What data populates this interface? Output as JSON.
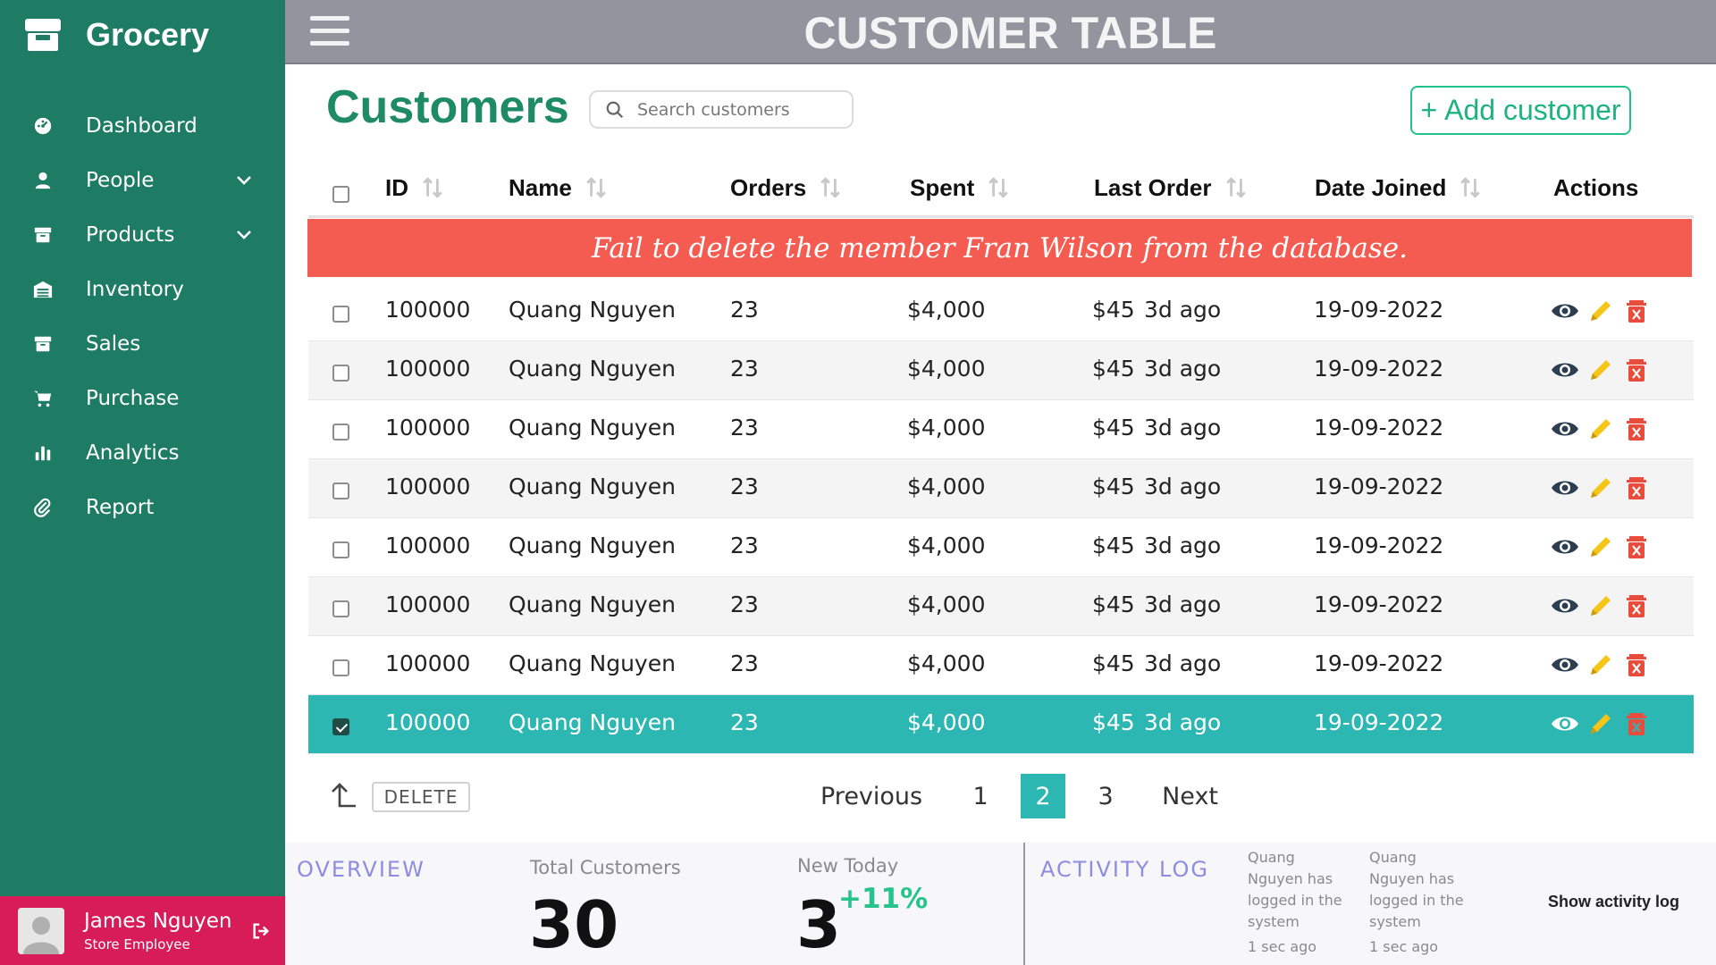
{
  "app": {
    "brand": "Grocery",
    "header_title": "CUSTOMER TABLE"
  },
  "sidebar": {
    "items": [
      {
        "label": "Dashboard",
        "icon": "dashboard-icon",
        "has_chevron": false
      },
      {
        "label": "People",
        "icon": "person-icon",
        "has_chevron": true
      },
      {
        "label": "Products",
        "icon": "box-icon",
        "has_chevron": true
      },
      {
        "label": "Inventory",
        "icon": "warehouse-icon",
        "has_chevron": false
      },
      {
        "label": "Sales",
        "icon": "store-icon",
        "has_chevron": false
      },
      {
        "label": "Purchase",
        "icon": "cart-icon",
        "has_chevron": false
      },
      {
        "label": "Analytics",
        "icon": "bar-chart-icon",
        "has_chevron": false
      },
      {
        "label": "Report",
        "icon": "paperclip-icon",
        "has_chevron": false
      }
    ],
    "user": {
      "name": "James Nguyen",
      "role": "Store Employee"
    }
  },
  "main": {
    "title": "Customers",
    "search_placeholder": "Search customers",
    "add_button": "Add customer",
    "add_button_symbol": "+",
    "columns": [
      "ID",
      "Name",
      "Orders",
      "Spent",
      "Last Order",
      "Date Joined",
      "Actions"
    ],
    "alert": "Fail to delete the member Fran Wilson from the database.",
    "rows": [
      {
        "id": "100000",
        "name": "Quang Nguyen",
        "orders": "23",
        "spent": "$4,000",
        "last_order_amount": "$45",
        "last_order_ago": "3d ago",
        "date_joined": "19-09-2022",
        "checked": false
      },
      {
        "id": "100000",
        "name": "Quang Nguyen",
        "orders": "23",
        "spent": "$4,000",
        "last_order_amount": "$45",
        "last_order_ago": "3d ago",
        "date_joined": "19-09-2022",
        "checked": false
      },
      {
        "id": "100000",
        "name": "Quang Nguyen",
        "orders": "23",
        "spent": "$4,000",
        "last_order_amount": "$45",
        "last_order_ago": "3d ago",
        "date_joined": "19-09-2022",
        "checked": false
      },
      {
        "id": "100000",
        "name": "Quang Nguyen",
        "orders": "23",
        "spent": "$4,000",
        "last_order_amount": "$45",
        "last_order_ago": "3d ago",
        "date_joined": "19-09-2022",
        "checked": false
      },
      {
        "id": "100000",
        "name": "Quang Nguyen",
        "orders": "23",
        "spent": "$4,000",
        "last_order_amount": "$45",
        "last_order_ago": "3d ago",
        "date_joined": "19-09-2022",
        "checked": false
      },
      {
        "id": "100000",
        "name": "Quang Nguyen",
        "orders": "23",
        "spent": "$4,000",
        "last_order_amount": "$45",
        "last_order_ago": "3d ago",
        "date_joined": "19-09-2022",
        "checked": false
      },
      {
        "id": "100000",
        "name": "Quang Nguyen",
        "orders": "23",
        "spent": "$4,000",
        "last_order_amount": "$45",
        "last_order_ago": "3d ago",
        "date_joined": "19-09-2022",
        "checked": false
      },
      {
        "id": "100000",
        "name": "Quang Nguyen",
        "orders": "23",
        "spent": "$4,000",
        "last_order_amount": "$45",
        "last_order_ago": "3d ago",
        "date_joined": "19-09-2022",
        "checked": true
      }
    ],
    "delete_button": "DELETE",
    "pagination": {
      "previous": "Previous",
      "pages": [
        "1",
        "2",
        "3"
      ],
      "current": "2",
      "next": "Next"
    }
  },
  "overview": {
    "title": "OVERVIEW",
    "total_customers_label": "Total Customers",
    "total_customers_value": "30",
    "new_today_label": "New Today",
    "new_today_value": "3",
    "new_today_delta": "+11%"
  },
  "activity": {
    "title": "ACTIVITY LOG",
    "entries": [
      {
        "text": "Quang Nguyen has logged in the system",
        "time": "1 sec ago"
      },
      {
        "text": "Quang Nguyen has logged in the system",
        "time": "1 sec ago"
      }
    ],
    "show_link": "Show activity log"
  },
  "colors": {
    "sidebar": "#1e7b64",
    "header": "#94949e",
    "accent_teal": "#2db7b3",
    "title_green": "#1e8a66",
    "alert_red": "#f45c52",
    "user_bar": "#d71c57",
    "delta_green": "#26c48c",
    "section_purple": "#8c8ce0"
  }
}
